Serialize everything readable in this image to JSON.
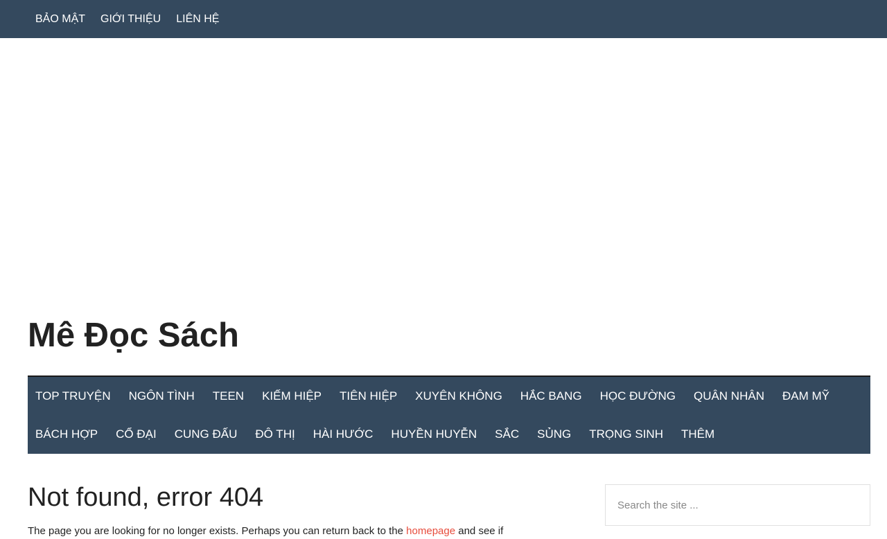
{
  "topbar": {
    "items": [
      "BẢO MẬT",
      "GIỚI THIỆU",
      "LIÊN HỆ"
    ]
  },
  "site": {
    "title": "Mê Đọc Sách"
  },
  "main_nav": {
    "row1": [
      "TOP TRUYỆN",
      "NGÔN TÌNH",
      "TEEN",
      "KIẾM HIỆP",
      "TIÊN HIỆP",
      "XUYÊN KHÔNG",
      "HẮC BANG",
      "HỌC ĐƯỜNG",
      "QUÂN NHÂN",
      "ĐAM MỸ"
    ],
    "row2": [
      "BÁCH HỢP",
      "CỔ ĐẠI",
      "CUNG ĐẤU",
      "ĐÔ THỊ",
      "HÀI HƯỚC",
      "HUYỀN HUYỄN",
      "SẮC",
      "SỦNG",
      "TRỌNG SINH",
      "THÊM"
    ]
  },
  "error": {
    "title": "Not found, error 404",
    "text_before": "The page you are looking for no longer exists. Perhaps you can return back to the ",
    "link": "homepage",
    "text_after": " and see if"
  },
  "search": {
    "placeholder": "Search the site ..."
  },
  "colors": {
    "nav_bg": "#34495e",
    "link": "#e74c3c"
  }
}
